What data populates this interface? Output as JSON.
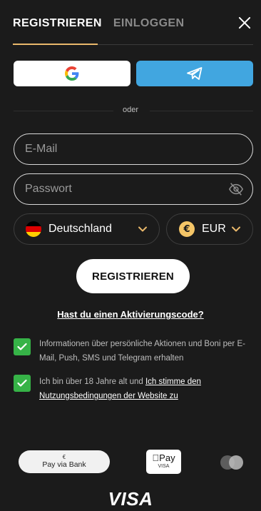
{
  "tabs": {
    "register": "REGISTRIEREN",
    "login": "EINLOGGEN"
  },
  "divider_text": "oder",
  "form": {
    "email_placeholder": "E-Mail",
    "password_placeholder": "Passwort",
    "country": "Deutschland",
    "currency": "EUR",
    "currency_symbol": "€",
    "submit_label": "REGISTRIEREN",
    "activation_link": "Hast du einen Aktivierungscode?"
  },
  "consents": {
    "marketing": "Informationen über persönliche Aktionen und Boni per E-Mail, Push, SMS und Telegram erhalten",
    "age_prefix": "Ich bin über 18 Jahre alt und ",
    "age_link": "Ich stimme den Nutzungsbedingungen der Website zu"
  },
  "payments": {
    "bank_top": "€",
    "bank_label": "Pay via Bank",
    "apple_pay": "Pay",
    "apple_pay_sub": "VISA",
    "visa": "VISA"
  },
  "colors": {
    "background": "#1b1b1b",
    "accent": "#e9b86b",
    "telegram": "#41a6e0",
    "checkbox": "#36b347"
  },
  "icons": [
    "google-icon",
    "telegram-icon",
    "eye-off-icon",
    "germany-flag-icon",
    "euro-icon",
    "chevron-down-icon",
    "check-icon",
    "close-icon",
    "mastercard-icon",
    "apple-icon"
  ]
}
